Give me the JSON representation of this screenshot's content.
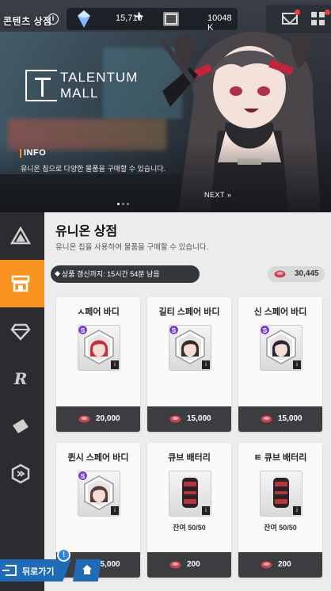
{
  "topbar": {
    "shop_title": "콘텐츠 상점",
    "info_icon": "i",
    "gems": "15,716",
    "plus": "+",
    "credits": "10048 K"
  },
  "banner": {
    "logo_line1": "TALENTUM",
    "logo_line2": "MALL",
    "info_heading": "INFO",
    "info_text": "유니온 칩으로 다양한 물품을 구매할 수 있습니다.",
    "next": "NEXT »",
    "page_count": 3,
    "current_page": 1
  },
  "sidebar": {
    "items": [
      {
        "icon": "triangle-stack-icon",
        "active": false
      },
      {
        "icon": "shop-icon",
        "active": true
      },
      {
        "icon": "diamond-icon",
        "active": false
      },
      {
        "icon": "r-logo-icon",
        "active": false
      },
      {
        "icon": "ticket-icon",
        "active": false
      },
      {
        "icon": "hexagon-icon",
        "active": false
      }
    ]
  },
  "main": {
    "title": "유니온 상점",
    "subtitle": "유니온 칩을 사용하여 물품을 구매할 수 있습니다.",
    "refresh": "상품 갱신까지: 15시간 54분 남음",
    "balance": "30,445"
  },
  "items": [
    {
      "name": "ㅅ페어 바디",
      "rarity": "S",
      "price": "20,000",
      "stock": "",
      "type": "portrait",
      "hair": "#c0303a"
    },
    {
      "name": "길티 스페어 바디",
      "rarity": "S",
      "price": "15,000",
      "stock": "",
      "type": "portrait",
      "hair": "#3a2a26"
    },
    {
      "name": "신 스페어 바디",
      "rarity": "S",
      "price": "15,000",
      "stock": "",
      "type": "portrait",
      "hair": "#2b2438"
    },
    {
      "name": "퀸시 스페어 바디",
      "rarity": "S",
      "price": "15,000",
      "stock": "",
      "type": "portrait",
      "hair": "#5a3a36"
    },
    {
      "name": "큐브 배터리",
      "rarity": "",
      "price": "200",
      "stock": "잔여 50/50",
      "type": "battery"
    },
    {
      "name": "ㅌ 큐브 배터리",
      "rarity": "",
      "price": "200",
      "stock": "잔여 50/50",
      "type": "battery"
    }
  ],
  "bottom": {
    "back_label": "뒤로가기",
    "alert": "!"
  },
  "colors": {
    "accent": "#f7931e",
    "nav_blue": "#1f6bb8",
    "rarity_purple": "#7a3fd1",
    "price_bar": "#3b3d41"
  }
}
